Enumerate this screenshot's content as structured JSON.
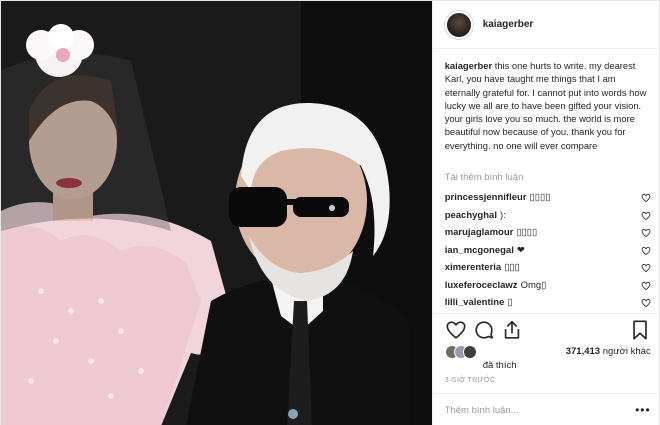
{
  "post": {
    "username": "kaiagerber",
    "caption_user": "kaiagerber",
    "caption_text": " this one hurts to write. my dearest Karl, you have taught me things that I am eternally grateful for. I cannot put into words how lucky we all are to have been gifted your vision. your girls love you so much. the world is more beautiful now because of you. thank you for everything. no one will ever compare"
  },
  "comments_section": {
    "load_more": "Tải thêm bình luận",
    "items": [
      {
        "user": "princessjennifleur",
        "text": "▯▯▯▯"
      },
      {
        "user": "peachyghal",
        "text": "):"
      },
      {
        "user": "marujaglamour",
        "text": "▯▯▯▯"
      },
      {
        "user": "ian_mcgonegal",
        "text": "❤"
      },
      {
        "user": "ximerenteria",
        "text": "▯▯▯"
      },
      {
        "user": "luxeferoceclawz",
        "text": "Omg▯"
      },
      {
        "user": "lilli_valentine",
        "text": "▯"
      }
    ]
  },
  "likes": {
    "count": "371,413",
    "suffix": " người khác",
    "word": "đã thích"
  },
  "timestamp": "3 GIỜ TRƯỚC",
  "add_comment": {
    "placeholder": "Thêm bình luận..."
  },
  "more_label": "•••",
  "icons": {
    "like": "heart-icon",
    "comment": "comment-bubble-icon",
    "share": "share-icon",
    "save": "bookmark-icon"
  }
}
